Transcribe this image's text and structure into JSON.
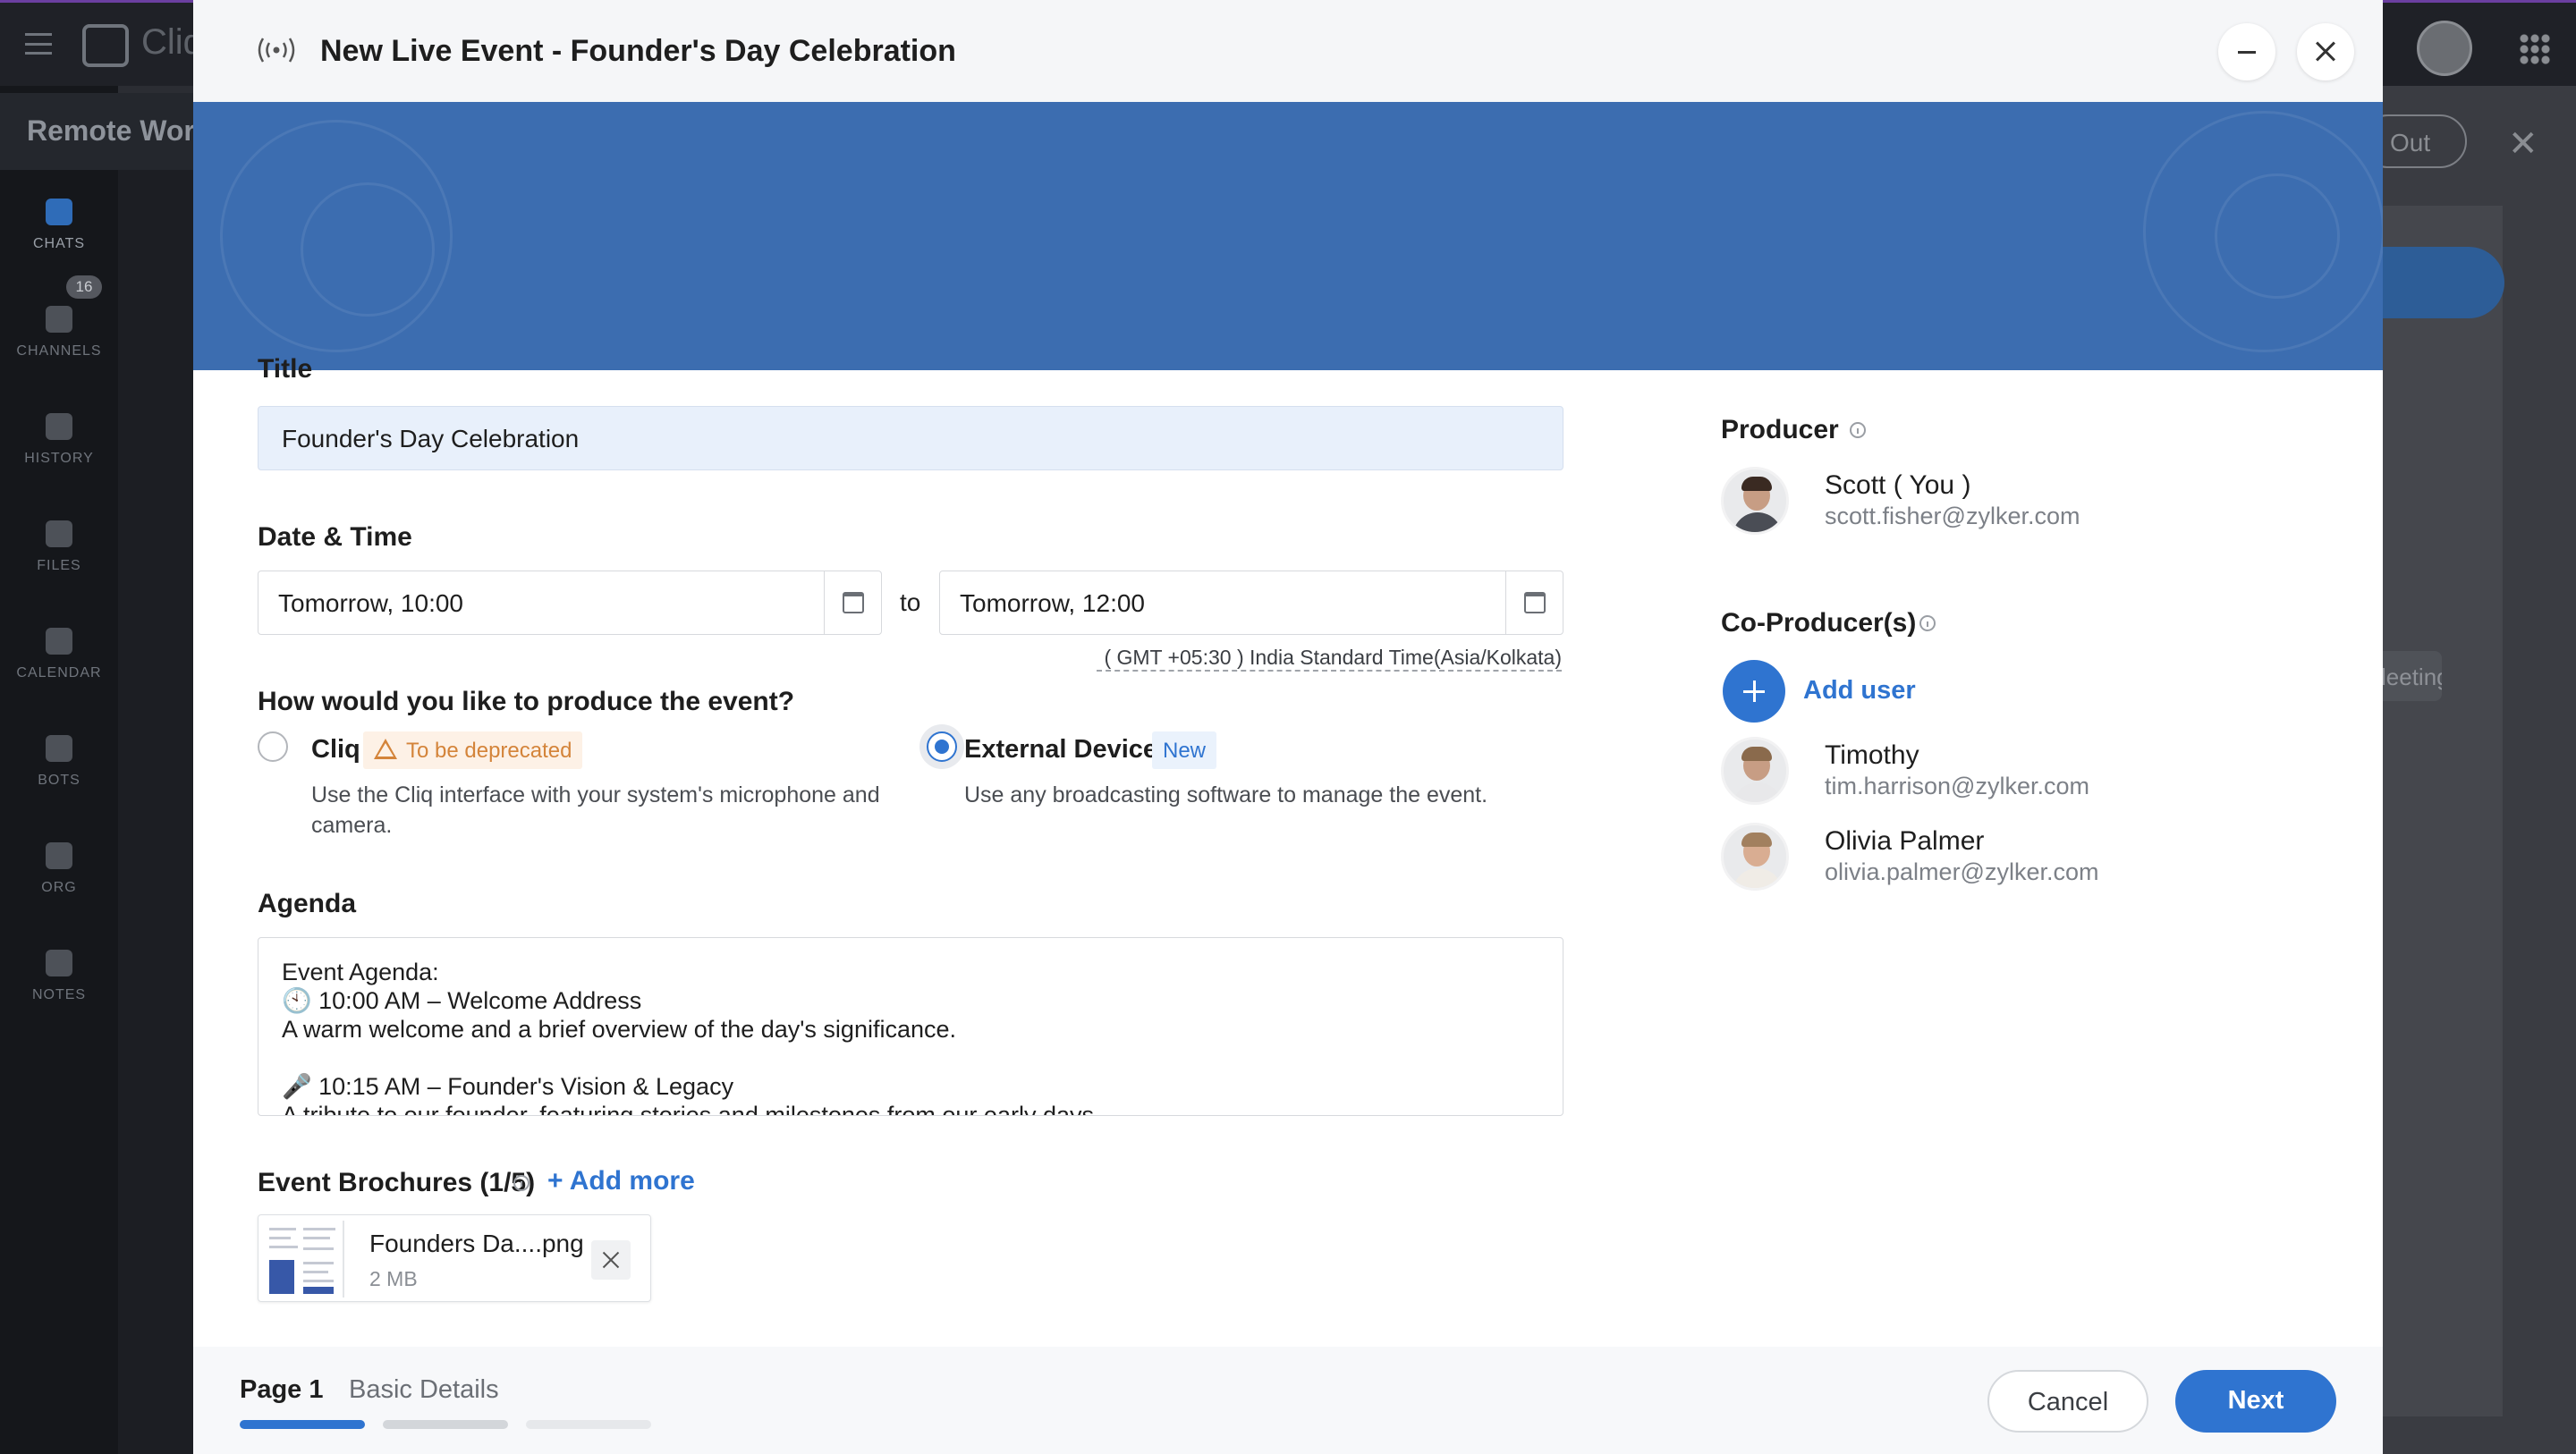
{
  "background": {
    "brand": "Cliq",
    "workspace": "Remote Wor",
    "nav": [
      {
        "label": "CHATS",
        "badge": "16"
      },
      {
        "label": "CHANNELS"
      },
      {
        "label": "HISTORY"
      },
      {
        "label": "FILES"
      },
      {
        "label": "CALENDAR"
      },
      {
        "label": "BOTS"
      },
      {
        "label": "ORG"
      },
      {
        "label": "NOTES"
      }
    ],
    "right_button": "Out",
    "right_chip": "leeting"
  },
  "dialog": {
    "title": "New Live Event - Founder's Day Celebration",
    "title_label": "Title",
    "title_value": "Founder's Day Celebration",
    "datetime_label": "Date & Time",
    "start": "Tomorrow, 10:00",
    "to": "to",
    "end": "Tomorrow, 12:00",
    "timezone": "( GMT +05:30 ) India Standard Time(Asia/Kolkata)",
    "produce_question": "How would you like to produce the event?",
    "options": [
      {
        "label": "Cliq",
        "tag": "To be deprecated",
        "desc": "Use the Cliq interface with your system's microphone and camera.",
        "selected": false
      },
      {
        "label": "External Device",
        "tag": "New",
        "desc": "Use any broadcasting software to manage the event.",
        "selected": true
      }
    ],
    "agenda_label": "Agenda",
    "agenda_lines": [
      "Event Agenda:",
      "🕙 10:00 AM – Welcome Address",
      "A warm welcome and a brief overview of the day's significance.",
      "",
      "🎤 10:15 AM – Founder's Vision & Legacy",
      "A tribute to our founder, featuring stories and milestones from our early days."
    ],
    "brochures_label": "Event Brochures (1/5)",
    "add_more": "+ Add more",
    "file": {
      "name": "Founders Da....png",
      "size": "2 MB"
    },
    "producer_label": "Producer",
    "producer": {
      "name": "Scott ( You )",
      "email": "scott.fisher@zylker.com"
    },
    "coproducer_label": "Co-Producer(s)",
    "add_user": "Add user",
    "coproducers": [
      {
        "name": "Timothy",
        "email": "tim.harrison@zylker.com"
      },
      {
        "name": "Olivia Palmer",
        "email": "olivia.palmer@zylker.com"
      }
    ],
    "footer": {
      "page": "Page 1",
      "page_name": "Basic Details",
      "cancel": "Cancel",
      "next": "Next",
      "steps_completed": 1,
      "steps_total": 3
    }
  },
  "colors": {
    "accent": "#2f74d0",
    "banner": "#3c6db0",
    "deprecated": "#d4843a"
  }
}
